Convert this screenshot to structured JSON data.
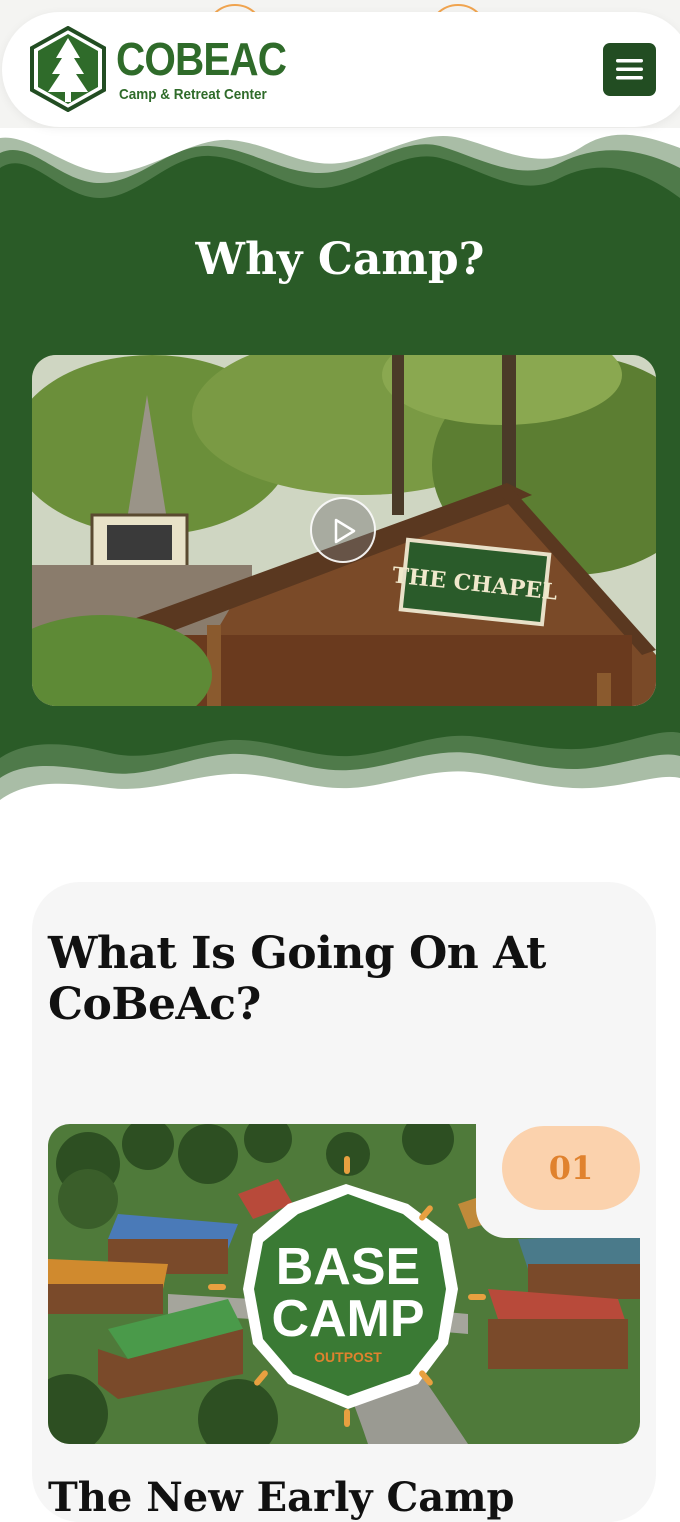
{
  "header": {
    "brand_name": "COBEAC",
    "brand_tagline": "Camp & Retreat Center",
    "menu_icon": "hamburger-icon"
  },
  "why_camp": {
    "title": "Why Camp?",
    "video_sign_text": "THE CHAPEL",
    "play_icon": "play-icon"
  },
  "events": {
    "title": "What Is Going On At CoBeAc?",
    "items": [
      {
        "number": "01",
        "logo_line1": "BASE",
        "logo_line2": "CAMP",
        "logo_line3": "OUTPOST",
        "caption": "The New Early Camp"
      }
    ]
  },
  "colors": {
    "brand_green": "#2f6b2a",
    "dark_green": "#224d22",
    "section_green": "#2a5b27",
    "orange": "#e0822e",
    "peach": "#fbd2ad"
  }
}
